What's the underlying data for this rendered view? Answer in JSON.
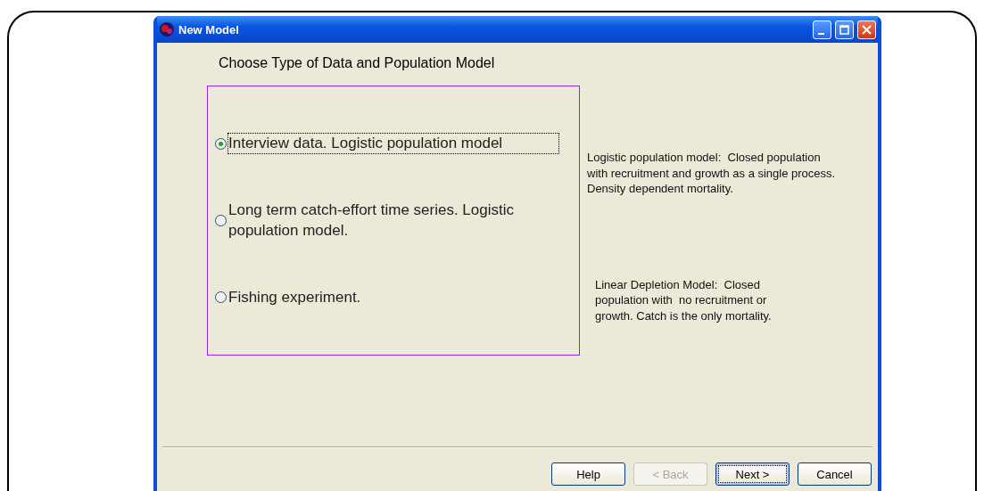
{
  "window": {
    "title": "New Model"
  },
  "heading": "Choose Type of Data and Population Model",
  "options": [
    {
      "label": "Interview data. Logistic population model",
      "selected": true
    },
    {
      "label": "Long term catch-effort time series. Logistic population model.",
      "selected": false
    },
    {
      "label": "Fishing experiment.",
      "selected": false
    }
  ],
  "descriptions": [
    "Logistic population model:  Closed population with recruitment and growth as a single process. Density dependent mortality.",
    "Linear Depletion Model:  Closed population with  no recruitment or growth. Catch is the only mortality."
  ],
  "buttons": [
    {
      "label": "Help",
      "disabled": false,
      "focused": false
    },
    {
      "label": "< Back",
      "disabled": true,
      "focused": false
    },
    {
      "label": "Next >",
      "disabled": false,
      "focused": true
    },
    {
      "label": "Cancel",
      "disabled": false,
      "focused": false
    }
  ]
}
